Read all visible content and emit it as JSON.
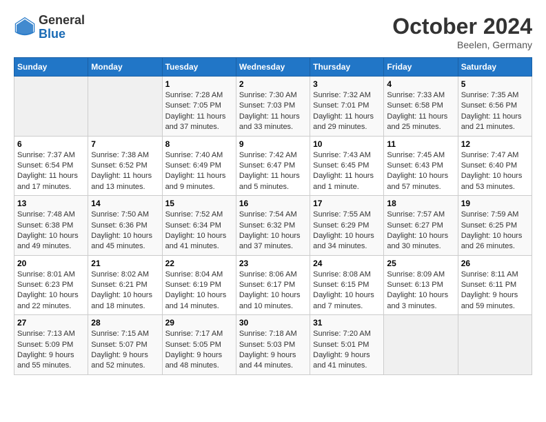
{
  "header": {
    "logo_general": "General",
    "logo_blue": "Blue",
    "month": "October 2024",
    "location": "Beelen, Germany"
  },
  "weekdays": [
    "Sunday",
    "Monday",
    "Tuesday",
    "Wednesday",
    "Thursday",
    "Friday",
    "Saturday"
  ],
  "weeks": [
    [
      {
        "day": "",
        "info": ""
      },
      {
        "day": "",
        "info": ""
      },
      {
        "day": "1",
        "info": "Sunrise: 7:28 AM\nSunset: 7:05 PM\nDaylight: 11 hours\nand 37 minutes."
      },
      {
        "day": "2",
        "info": "Sunrise: 7:30 AM\nSunset: 7:03 PM\nDaylight: 11 hours\nand 33 minutes."
      },
      {
        "day": "3",
        "info": "Sunrise: 7:32 AM\nSunset: 7:01 PM\nDaylight: 11 hours\nand 29 minutes."
      },
      {
        "day": "4",
        "info": "Sunrise: 7:33 AM\nSunset: 6:58 PM\nDaylight: 11 hours\nand 25 minutes."
      },
      {
        "day": "5",
        "info": "Sunrise: 7:35 AM\nSunset: 6:56 PM\nDaylight: 11 hours\nand 21 minutes."
      }
    ],
    [
      {
        "day": "6",
        "info": "Sunrise: 7:37 AM\nSunset: 6:54 PM\nDaylight: 11 hours\nand 17 minutes."
      },
      {
        "day": "7",
        "info": "Sunrise: 7:38 AM\nSunset: 6:52 PM\nDaylight: 11 hours\nand 13 minutes."
      },
      {
        "day": "8",
        "info": "Sunrise: 7:40 AM\nSunset: 6:49 PM\nDaylight: 11 hours\nand 9 minutes."
      },
      {
        "day": "9",
        "info": "Sunrise: 7:42 AM\nSunset: 6:47 PM\nDaylight: 11 hours\nand 5 minutes."
      },
      {
        "day": "10",
        "info": "Sunrise: 7:43 AM\nSunset: 6:45 PM\nDaylight: 11 hours\nand 1 minute."
      },
      {
        "day": "11",
        "info": "Sunrise: 7:45 AM\nSunset: 6:43 PM\nDaylight: 10 hours\nand 57 minutes."
      },
      {
        "day": "12",
        "info": "Sunrise: 7:47 AM\nSunset: 6:40 PM\nDaylight: 10 hours\nand 53 minutes."
      }
    ],
    [
      {
        "day": "13",
        "info": "Sunrise: 7:48 AM\nSunset: 6:38 PM\nDaylight: 10 hours\nand 49 minutes."
      },
      {
        "day": "14",
        "info": "Sunrise: 7:50 AM\nSunset: 6:36 PM\nDaylight: 10 hours\nand 45 minutes."
      },
      {
        "day": "15",
        "info": "Sunrise: 7:52 AM\nSunset: 6:34 PM\nDaylight: 10 hours\nand 41 minutes."
      },
      {
        "day": "16",
        "info": "Sunrise: 7:54 AM\nSunset: 6:32 PM\nDaylight: 10 hours\nand 37 minutes."
      },
      {
        "day": "17",
        "info": "Sunrise: 7:55 AM\nSunset: 6:29 PM\nDaylight: 10 hours\nand 34 minutes."
      },
      {
        "day": "18",
        "info": "Sunrise: 7:57 AM\nSunset: 6:27 PM\nDaylight: 10 hours\nand 30 minutes."
      },
      {
        "day": "19",
        "info": "Sunrise: 7:59 AM\nSunset: 6:25 PM\nDaylight: 10 hours\nand 26 minutes."
      }
    ],
    [
      {
        "day": "20",
        "info": "Sunrise: 8:01 AM\nSunset: 6:23 PM\nDaylight: 10 hours\nand 22 minutes."
      },
      {
        "day": "21",
        "info": "Sunrise: 8:02 AM\nSunset: 6:21 PM\nDaylight: 10 hours\nand 18 minutes."
      },
      {
        "day": "22",
        "info": "Sunrise: 8:04 AM\nSunset: 6:19 PM\nDaylight: 10 hours\nand 14 minutes."
      },
      {
        "day": "23",
        "info": "Sunrise: 8:06 AM\nSunset: 6:17 PM\nDaylight: 10 hours\nand 10 minutes."
      },
      {
        "day": "24",
        "info": "Sunrise: 8:08 AM\nSunset: 6:15 PM\nDaylight: 10 hours\nand 7 minutes."
      },
      {
        "day": "25",
        "info": "Sunrise: 8:09 AM\nSunset: 6:13 PM\nDaylight: 10 hours\nand 3 minutes."
      },
      {
        "day": "26",
        "info": "Sunrise: 8:11 AM\nSunset: 6:11 PM\nDaylight: 9 hours\nand 59 minutes."
      }
    ],
    [
      {
        "day": "27",
        "info": "Sunrise: 7:13 AM\nSunset: 5:09 PM\nDaylight: 9 hours\nand 55 minutes."
      },
      {
        "day": "28",
        "info": "Sunrise: 7:15 AM\nSunset: 5:07 PM\nDaylight: 9 hours\nand 52 minutes."
      },
      {
        "day": "29",
        "info": "Sunrise: 7:17 AM\nSunset: 5:05 PM\nDaylight: 9 hours\nand 48 minutes."
      },
      {
        "day": "30",
        "info": "Sunrise: 7:18 AM\nSunset: 5:03 PM\nDaylight: 9 hours\nand 44 minutes."
      },
      {
        "day": "31",
        "info": "Sunrise: 7:20 AM\nSunset: 5:01 PM\nDaylight: 9 hours\nand 41 minutes."
      },
      {
        "day": "",
        "info": ""
      },
      {
        "day": "",
        "info": ""
      }
    ]
  ]
}
